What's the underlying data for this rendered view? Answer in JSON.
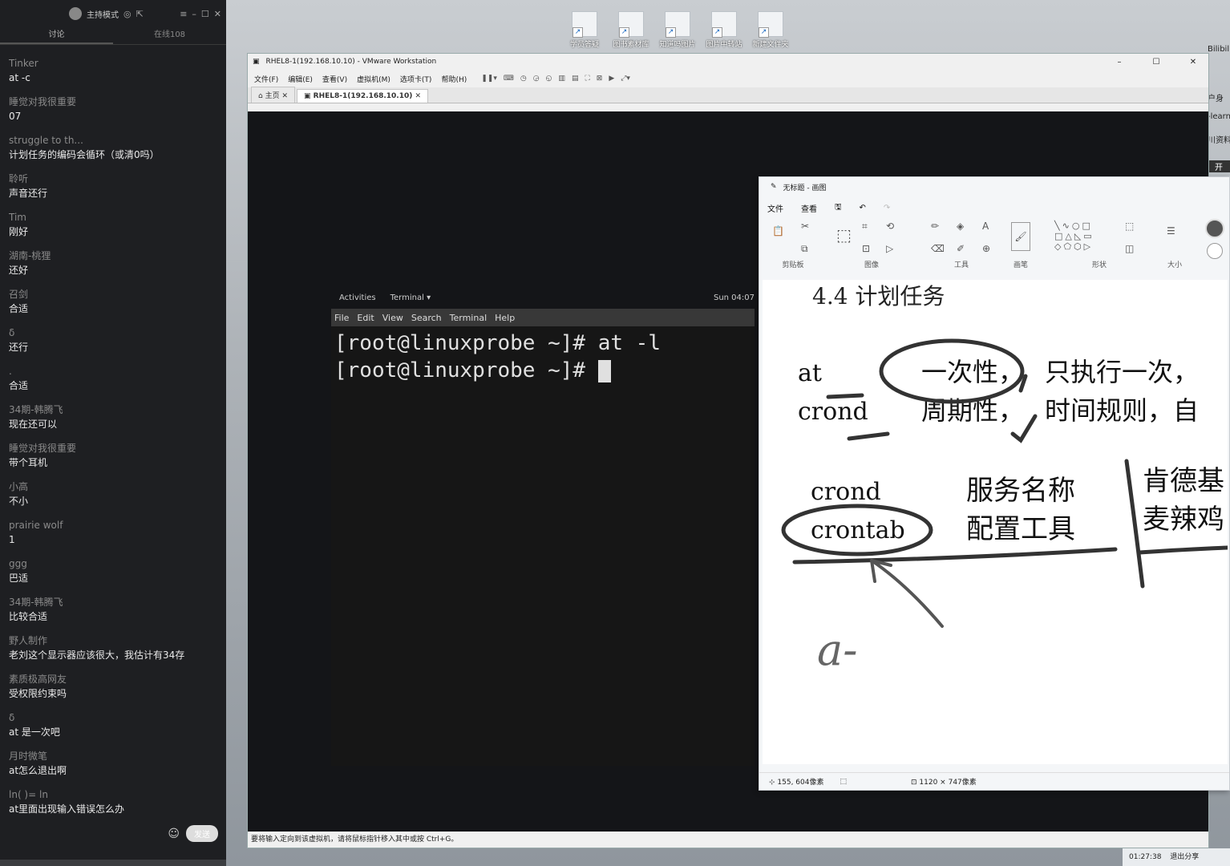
{
  "chat": {
    "header_title": "主持模式",
    "tabs": [
      "讨论",
      "在线108"
    ],
    "messages": [
      {
        "user": "Tinker",
        "text": "at -c"
      },
      {
        "user": "睡觉对我很重要",
        "text": "07"
      },
      {
        "user": "struggle to th...",
        "text": "计划任务的编码会循环（或清0吗）"
      },
      {
        "user": "聆听",
        "text": "声音还行"
      },
      {
        "user": "Tim",
        "text": "刚好"
      },
      {
        "user": "湖南-桃狸",
        "text": "还好"
      },
      {
        "user": "召剑",
        "text": "合适"
      },
      {
        "user": "δ",
        "text": "还行"
      },
      {
        "user": ".",
        "text": "合适"
      },
      {
        "user": "34期-韩腾飞",
        "text": "现在还可以"
      },
      {
        "user": "睡觉对我很重要",
        "text": "带个耳机"
      },
      {
        "user": "小高",
        "text": "不小"
      },
      {
        "user": "prairie wolf",
        "text": "1"
      },
      {
        "user": "ggg",
        "text": "巴适"
      },
      {
        "user": "34期-韩腾飞",
        "text": "比较合适"
      },
      {
        "user": "野人制作",
        "text": "老刘这个显示器应该很大，我估计有34存"
      },
      {
        "user": "素质极高网友",
        "text": "受权限约束吗"
      },
      {
        "user": "δ",
        "text": "at 是一次吧"
      },
      {
        "user": "月时微笔",
        "text": "at怎么退出啊"
      },
      {
        "user": "ln(   )=     ln",
        "text": "at里面出现输入错误怎么办"
      }
    ],
    "send_label": "发送"
  },
  "desktop_icons": [
    "学员答疑",
    "图书素材库",
    "知道吗图片",
    "图片中转站",
    "新建文件夹"
  ],
  "edge_text": [
    "Bilibili",
    "户身",
    "-learn",
    "川资料",
    "开"
  ],
  "vmware": {
    "title": "RHEL8-1(192.168.10.10) - VMware Workstation",
    "menu": [
      "文件(F)",
      "编辑(E)",
      "查看(V)",
      "虚拟机(M)",
      "选项卡(T)",
      "帮助(H)"
    ],
    "tabs": [
      "主页",
      "RHEL8-1(192.168.10.10)"
    ],
    "status": "要将输入定向到该虚拟机，请将鼠标指针移入其中或按 Ctrl+G。"
  },
  "gnome": {
    "activities": "Activities",
    "app": "Terminal ▾",
    "clock": "Sun 04:07"
  },
  "terminal": {
    "menu": [
      "File",
      "Edit",
      "View",
      "Search",
      "Terminal",
      "Help"
    ],
    "lines": [
      "[root@linuxprobe ~]# at -l",
      "[root@linuxprobe ~]# "
    ]
  },
  "paint": {
    "title": "无标题 - 画图",
    "menu": [
      "文件",
      "查看"
    ],
    "groups": [
      "剪贴板",
      "图像",
      "工具",
      "画笔",
      "形状",
      "大小"
    ],
    "status_pos": "155, 604像素",
    "status_size": "1120 × 747像素",
    "content": {
      "heading": "4.4 计划任务",
      "row1_left": "at",
      "row1_mid": "一次性，",
      "row1_right": "只执行一次，",
      "row2_left": "crond",
      "row2_mid": "周期性，",
      "row2_right": "时间规则，自",
      "row3_left": "crond",
      "row3_mid": "服务名称",
      "row4_left": "crontab",
      "row4_mid": "配置工具",
      "right1": "肯德基",
      "right2": "麦辣鸡",
      "hand": "a-"
    }
  },
  "tray": {
    "time": "01:27:38",
    "action": "退出分享"
  }
}
